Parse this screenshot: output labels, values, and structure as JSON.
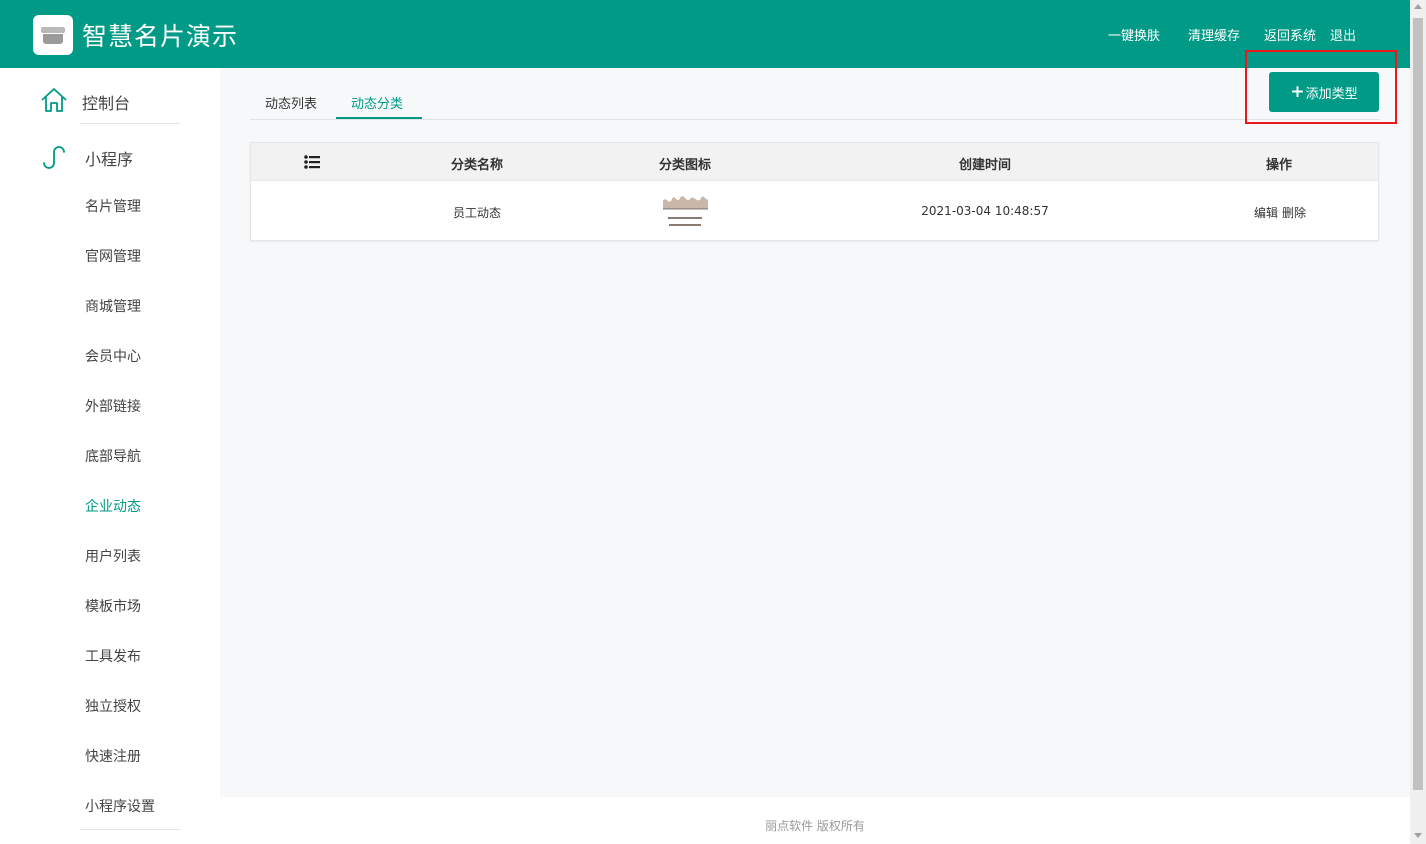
{
  "header": {
    "title": "智慧名片演示",
    "nav": [
      "一键换肤",
      "清理缓存",
      "返回系统",
      "退出"
    ],
    "brand_color": "#009a86"
  },
  "sidebar": {
    "console_label": "控制台",
    "section_label": "小程序",
    "items": [
      "名片管理",
      "官网管理",
      "商城管理",
      "会员中心",
      "外部链接",
      "底部导航",
      "企业动态",
      "用户列表",
      "模板市场",
      "工具发布",
      "独立授权",
      "快速注册",
      "小程序设置"
    ],
    "active_item": "企业动态"
  },
  "tabs": [
    "动态列表",
    "动态分类"
  ],
  "active_tab": "动态分类",
  "add_button_label": "添加类型",
  "table": {
    "columns": [
      "分类名称",
      "分类图标",
      "创建时间",
      "操作"
    ],
    "rows": [
      {
        "name": "员工动态",
        "created": "2021-03-04 10:48:57",
        "edit": "编辑",
        "delete": "删除"
      }
    ]
  },
  "footer_text": "丽点软件 版权所有"
}
